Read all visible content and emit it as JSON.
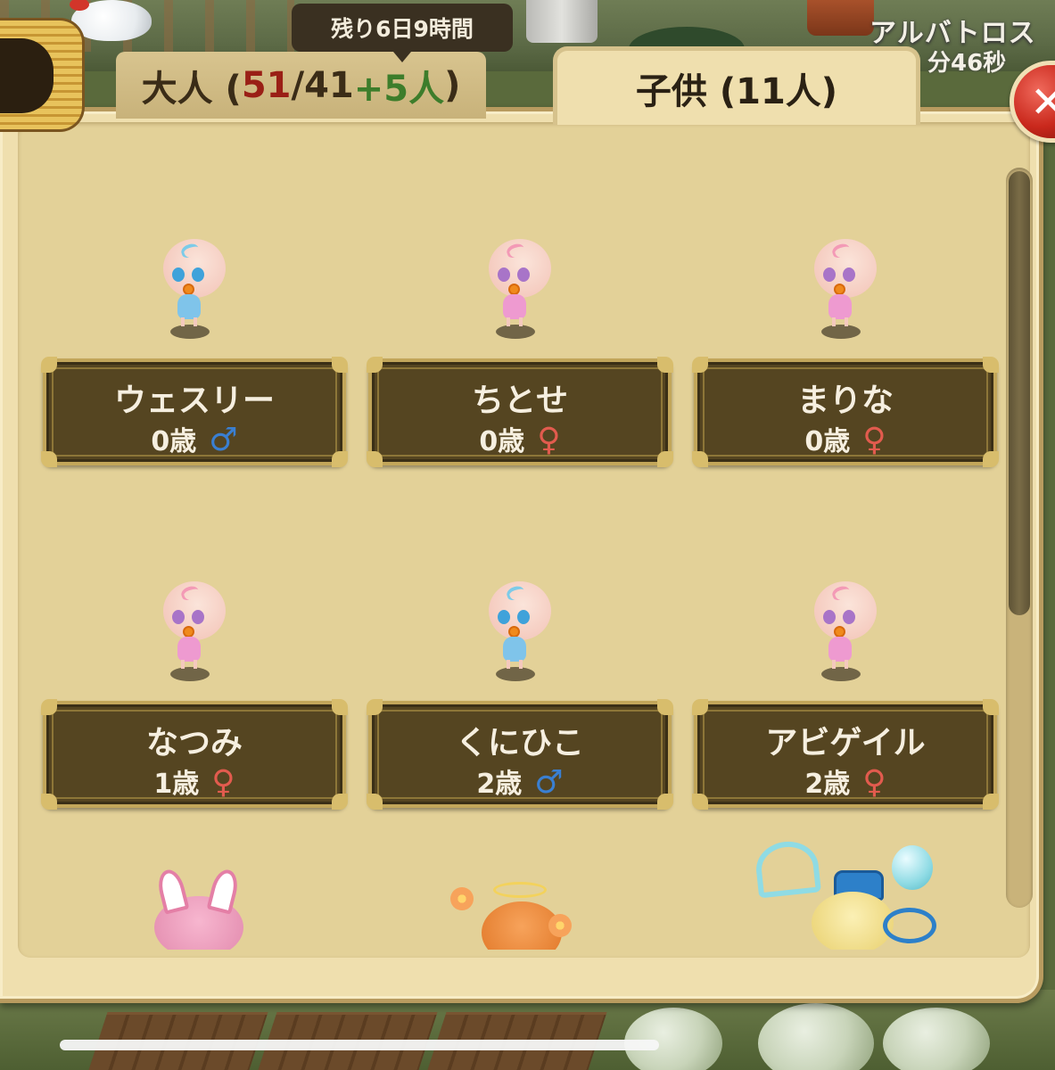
{
  "header": {
    "timer_text": "残り6日9時間",
    "top_right_text": "アルバトロス",
    "top_right_sub": "分46秒"
  },
  "tabs": {
    "adults": {
      "prefix": "大人 (",
      "current": "51",
      "slash_total": "/41",
      "bonus": "+5人",
      "suffix": ")"
    },
    "children": {
      "label": "子供 (11人)"
    }
  },
  "close_button": {
    "label": "✕"
  },
  "colors": {
    "male": "#3a7fd1",
    "female": "#e25b4e"
  },
  "children": [
    {
      "name": "ウェスリー",
      "age": "0歳",
      "gender": "male",
      "symbol": "♂"
    },
    {
      "name": "ちとせ",
      "age": "0歳",
      "gender": "female",
      "symbol": "♀"
    },
    {
      "name": "まりな",
      "age": "0歳",
      "gender": "female",
      "symbol": "♀"
    },
    {
      "name": "なつみ",
      "age": "1歳",
      "gender": "female",
      "symbol": "♀"
    },
    {
      "name": "くにひこ",
      "age": "2歳",
      "gender": "male",
      "symbol": "♂"
    },
    {
      "name": "アビゲイル",
      "age": "2歳",
      "gender": "female",
      "symbol": "♀"
    }
  ],
  "scroll": {
    "visible_fraction": 0.6
  }
}
